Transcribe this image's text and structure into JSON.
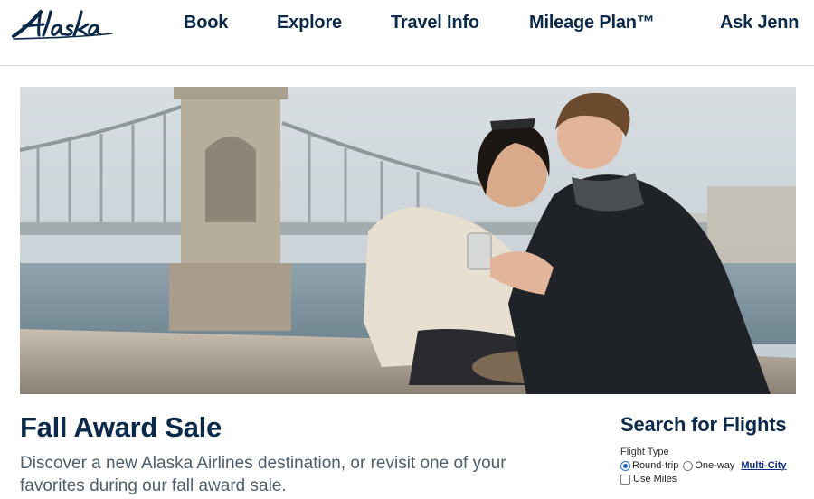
{
  "brand": {
    "logo_text": "Alaska",
    "color": "#0b2a4a"
  },
  "nav": {
    "items": [
      {
        "label": "Book"
      },
      {
        "label": "Explore"
      },
      {
        "label": "Travel Info"
      },
      {
        "label": "Mileage Plan™"
      },
      {
        "label": "Ask Jenn"
      }
    ]
  },
  "hero": {
    "image": "couple-on-bridge-looking-at-phone"
  },
  "promo": {
    "title": "Fall Award Sale",
    "description": "Discover a new Alaska Airlines destination, or revisit one of your favorites during our fall award sale."
  },
  "search": {
    "title": "Search for Flights",
    "flight_type_label": "Flight Type",
    "options": [
      {
        "label": "Round-trip",
        "selected": true
      },
      {
        "label": "One-way",
        "selected": false
      }
    ],
    "multi_city_link": "Multi-City",
    "use_miles_label": "Use Miles",
    "use_miles_checked": false
  }
}
